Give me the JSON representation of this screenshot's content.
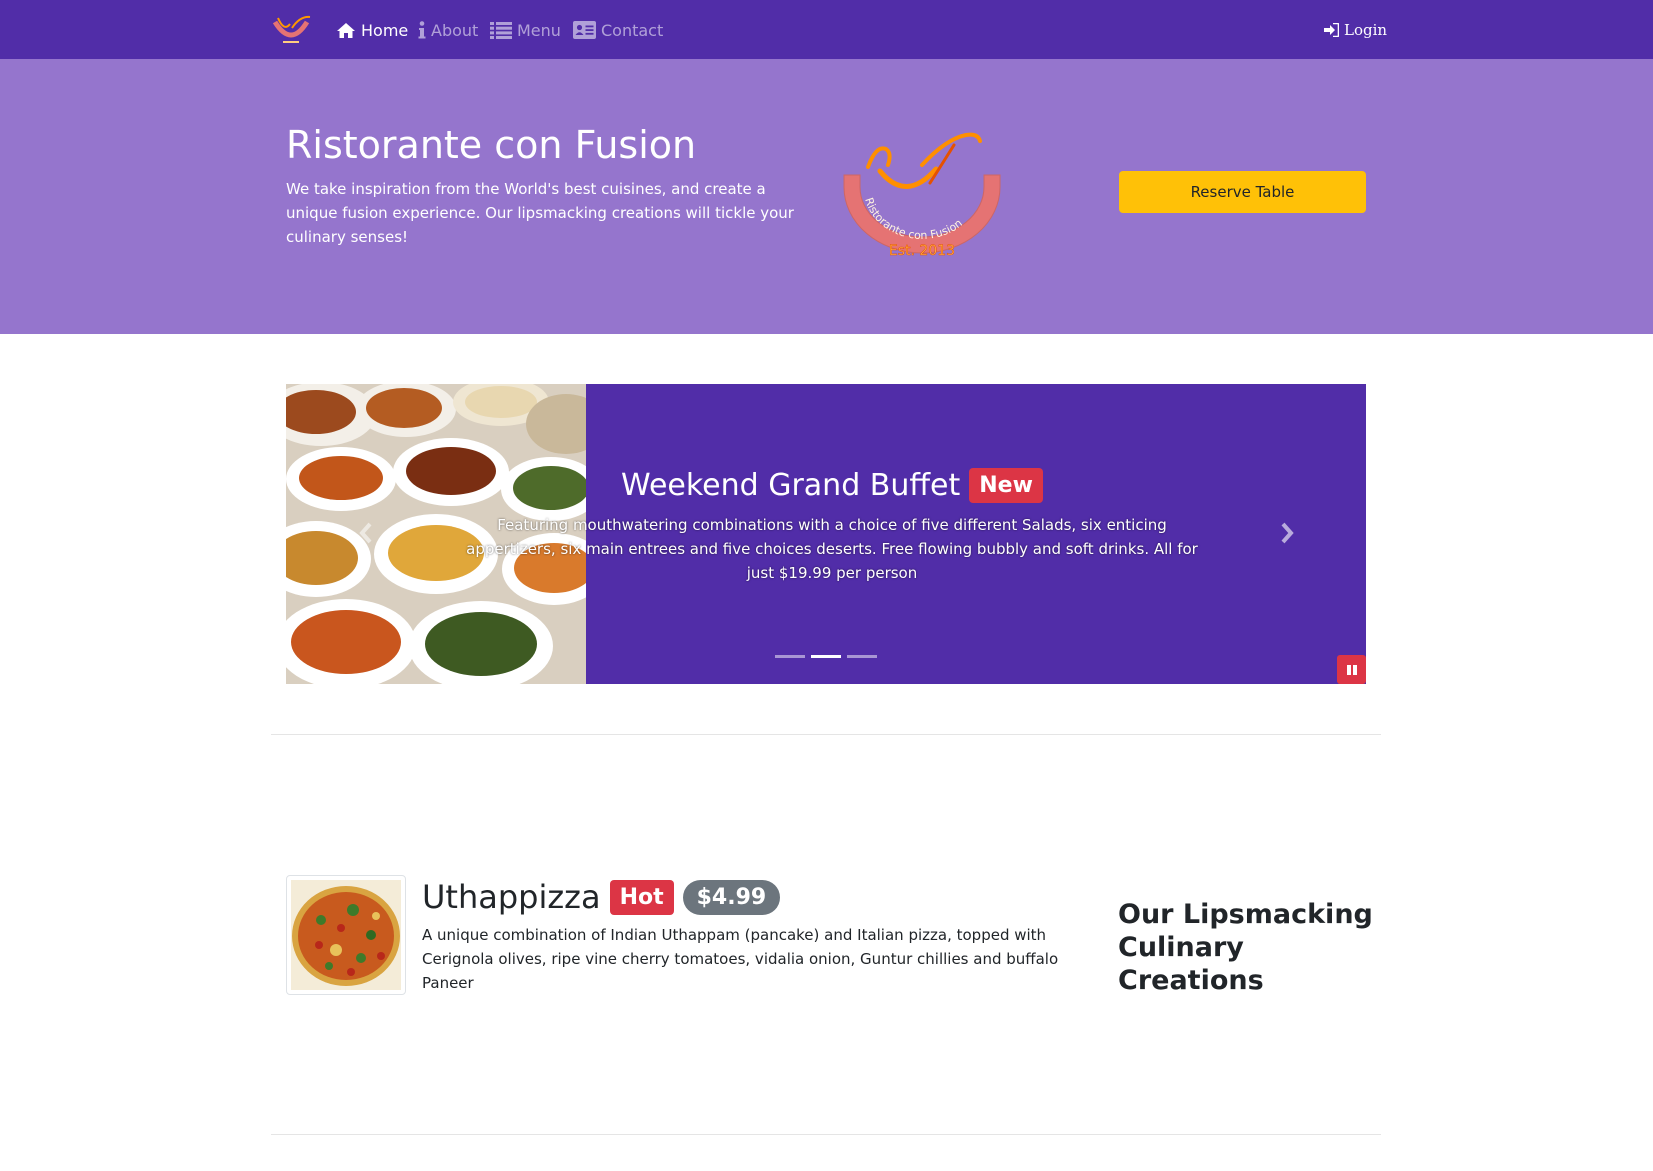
{
  "nav": {
    "home": "Home",
    "about": "About",
    "menu": "Menu",
    "contact": "Contact",
    "login": "Login"
  },
  "jumbotron": {
    "title": "Ristorante con Fusion",
    "text": "We take inspiration from the World's best cuisines, and create a unique fusion experience. Our lipsmacking creations will tickle your culinary senses!",
    "reserve_button": "Reserve Table",
    "logo_text": "Ristorante con Fusion",
    "logo_est": "Est. 2013"
  },
  "carousel": {
    "title": "Weekend Grand Buffet",
    "badge": "New",
    "text": "Featuring mouthwatering combinations with a choice of five different Salads, six enticing appertizers, six main entrees and five choices deserts. Free flowing bubbly and soft drinks. All for just $19.99 per person",
    "active_slide": 1,
    "slide_count": 3
  },
  "dish": {
    "name": "Uthappizza",
    "badge": "Hot",
    "price": "$4.99",
    "description": "A unique combination of Indian Uthappam (pancake) and Italian pizza, topped with Cerignola olives, ripe vine cherry tomatoes, vidalia onion, Guntur chillies and buffalo Paneer"
  },
  "side": {
    "heading": "Our Lipsmacking Culinary Creations"
  },
  "colors": {
    "primary": "#512da8",
    "primary_light": "#9575cd",
    "warning": "#ffc107",
    "danger": "#dc3545",
    "secondary": "#6c757d"
  }
}
